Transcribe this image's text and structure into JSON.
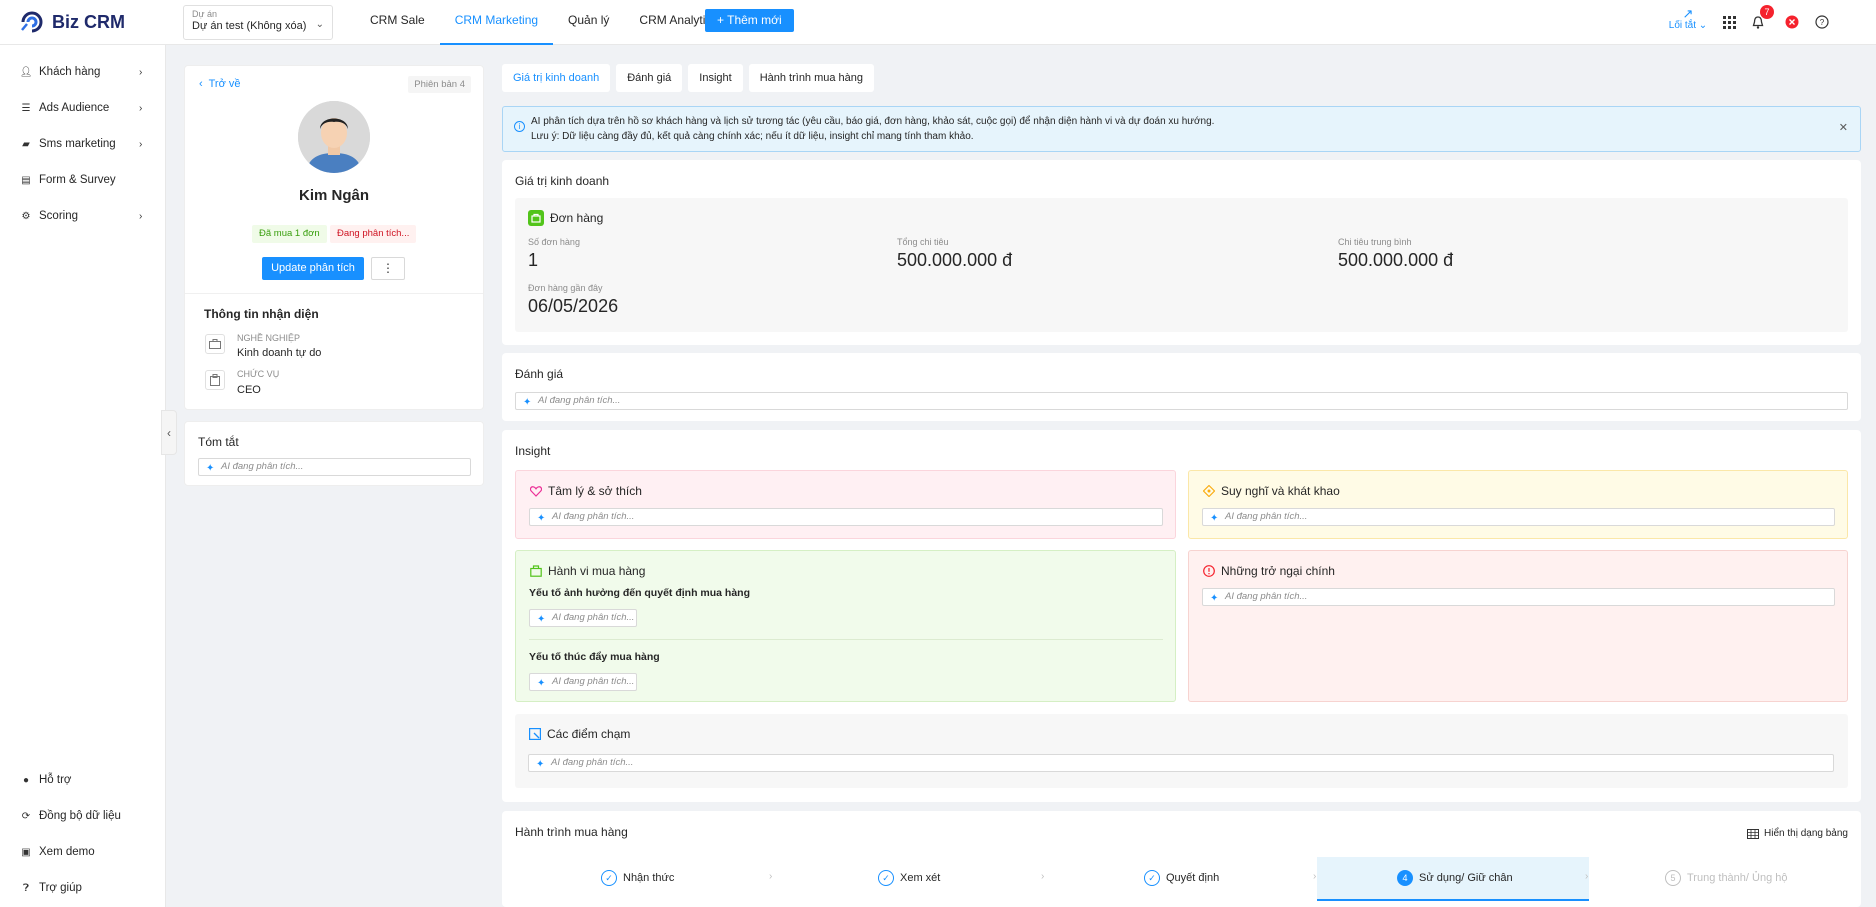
{
  "app": {
    "logo_text_1": "Biz",
    "logo_text_2": "CRM"
  },
  "project": {
    "label": "Dự án",
    "value": "Dự án test (Không xóa)"
  },
  "nav": {
    "items": [
      "CRM Sale",
      "CRM Marketing",
      "Quản lý",
      "CRM Analytics"
    ],
    "active": "CRM Marketing",
    "add_button": "+ Thêm mới"
  },
  "top_right": {
    "shortcut": "Lối tắt",
    "notifications_count": "7"
  },
  "sidebar": {
    "items": [
      {
        "label": "Khách hàng",
        "icon": "user-icon"
      },
      {
        "label": "Ads Audience",
        "icon": "list-icon"
      },
      {
        "label": "Sms marketing",
        "icon": "message-icon"
      },
      {
        "label": "Form & Survey",
        "icon": "clipboard-icon"
      },
      {
        "label": "Scoring",
        "icon": "gear-icon"
      }
    ],
    "bottom_items": [
      {
        "label": "Hỗ trợ",
        "icon": "info-icon"
      },
      {
        "label": "Đồng bộ dữ liệu",
        "icon": "sync-icon"
      },
      {
        "label": "Xem demo",
        "icon": "demo-icon"
      },
      {
        "label": "Trợ giúp",
        "icon": "help-icon"
      }
    ]
  },
  "profile": {
    "back": "Trở về",
    "version": "Phiên bản 4",
    "name": "Kim Ngân",
    "tag_green": "Đã mua 1 đơn",
    "tag_red": "Đang phân tích...",
    "update_button": "Update phân tích",
    "more_button": "⋮",
    "identity_title": "Thông tin nhận diện",
    "job_label": "Nghề nghiệp",
    "job_value": "Kinh doanh tự do",
    "position_label": "Chức vụ",
    "position_value": "CEO",
    "summary_title": "Tóm tắt",
    "ai_placeholder": "AI đang phân tích..."
  },
  "tabs": [
    "Giá trị kinh doanh",
    "Đánh giá",
    "Insight",
    "Hành trình mua hàng"
  ],
  "alert": {
    "line1": "AI phân tích dựa trên hồ sơ khách hàng và lịch sử tương tác (yêu cầu, báo giá, đơn hàng, khảo sát, cuộc gọi) để nhận diện hành vi và dự đoán xu hướng.",
    "line2": "Lưu ý: Dữ liệu càng đầy đủ, kết quả càng chính xác; nếu ít dữ liệu, insight chỉ mang tính tham khảo."
  },
  "business_value": {
    "title": "Giá trị kinh doanh",
    "orders_title": "Đơn hàng",
    "order_count_label": "Số đơn hàng",
    "order_count_value": "1",
    "total_spend_label": "Tổng chi tiêu",
    "total_spend_value": "500.000.000 đ",
    "avg_spend_label": "Chi tiêu trung bình",
    "avg_spend_value": "500.000.000 đ",
    "recent_order_label": "Đơn hàng gần đây",
    "recent_order_value": "06/05/2026"
  },
  "evaluation": {
    "title": "Đánh giá",
    "ai_placeholder": "AI đang phân tích..."
  },
  "insight": {
    "title": "Insight",
    "psych": "Tâm lý & sở thích",
    "thoughts": "Suy nghĩ và khát khao",
    "behavior": "Hành vi mua hàng",
    "behavior_factor": "Yếu tố ảnh hưởng đến quyết định mua hàng",
    "behavior_driver": "Yếu tố thúc đẩy mua hàng",
    "obstacles": "Những trở ngại chính",
    "touchpoints": "Các điểm chạm",
    "ai_placeholder": "AI đang phân tích..."
  },
  "journey": {
    "title": "Hành trình mua hàng",
    "table_view": "Hiển thị dạng bảng",
    "steps": [
      "Nhận thức",
      "Xem xét",
      "Quyết định",
      "Sử dụng/ Giữ chân",
      "Trung thành/ Ủng hộ"
    ],
    "current_step_number": "4",
    "last_step_number": "5"
  },
  "colors": {
    "accent": "#1890ff",
    "psych_bg": "#fff0f3",
    "thoughts_bg": "#fffbe6",
    "behavior_bg": "#f1fbeb",
    "obstacles_bg": "#fff1f0"
  }
}
